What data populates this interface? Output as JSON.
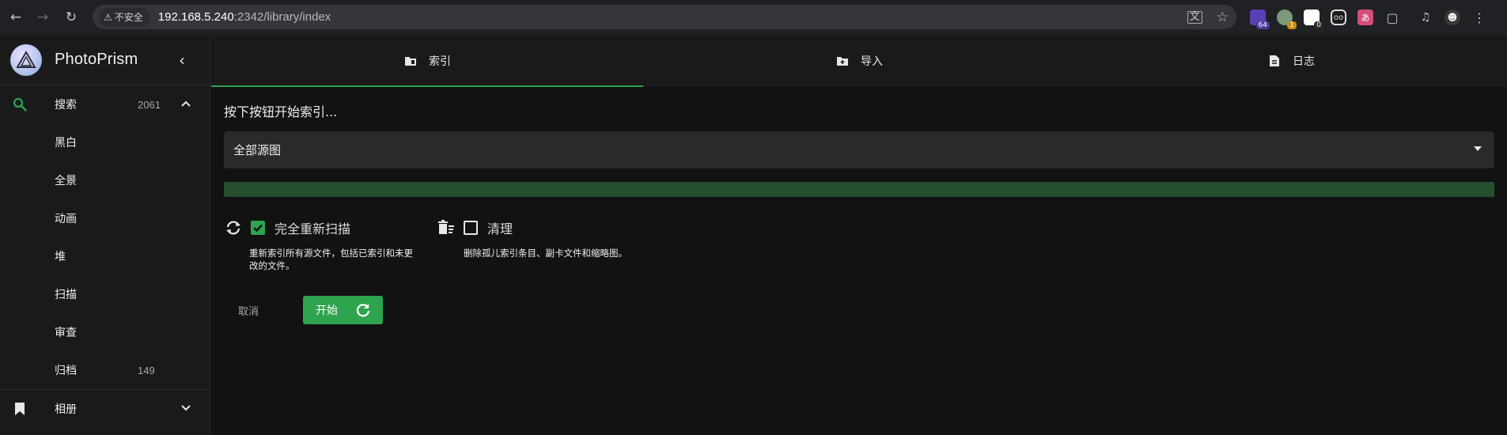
{
  "browser": {
    "security_label": "不安全",
    "url_host": "192.168.5.240",
    "url_rest": ":2342/library/index",
    "extension_badges": [
      "64",
      "1",
      "0"
    ]
  },
  "sidebar": {
    "brand": "PhotoPrism",
    "items": [
      {
        "label": "搜索",
        "count": "2061",
        "icon": "search-icon"
      },
      {
        "label": "黑白",
        "count": ""
      },
      {
        "label": "全景",
        "count": ""
      },
      {
        "label": "动画",
        "count": ""
      },
      {
        "label": "堆",
        "count": ""
      },
      {
        "label": "扫描",
        "count": ""
      },
      {
        "label": "审查",
        "count": ""
      },
      {
        "label": "归档",
        "count": "149"
      },
      {
        "label": "相册",
        "count": "",
        "icon": "bookmark-icon"
      }
    ]
  },
  "tabs": [
    {
      "label": "索引",
      "icon": "folder-icon",
      "active": true
    },
    {
      "label": "导入",
      "icon": "folder-plus-icon",
      "active": false
    },
    {
      "label": "日志",
      "icon": "file-icon",
      "active": false
    }
  ],
  "main": {
    "prompt": "按下按钮开始索引...",
    "select_value": "全部源图",
    "progress": 0,
    "options": {
      "rescan_label": "完全重新扫描",
      "rescan_checked": true,
      "rescan_hint_line1": "重新索引所有源文件，包括已索引和未更",
      "rescan_hint_line2": "改的文件。",
      "cleanup_label": "清理",
      "cleanup_checked": false,
      "cleanup_hint": "删除孤儿索引条目、副卡文件和缩略图。"
    },
    "cancel_label": "取消",
    "start_label": "开始"
  },
  "colors": {
    "accent": "#2ea44f",
    "progress_track": "#254f2d",
    "search_icon": "#2ea44f"
  }
}
